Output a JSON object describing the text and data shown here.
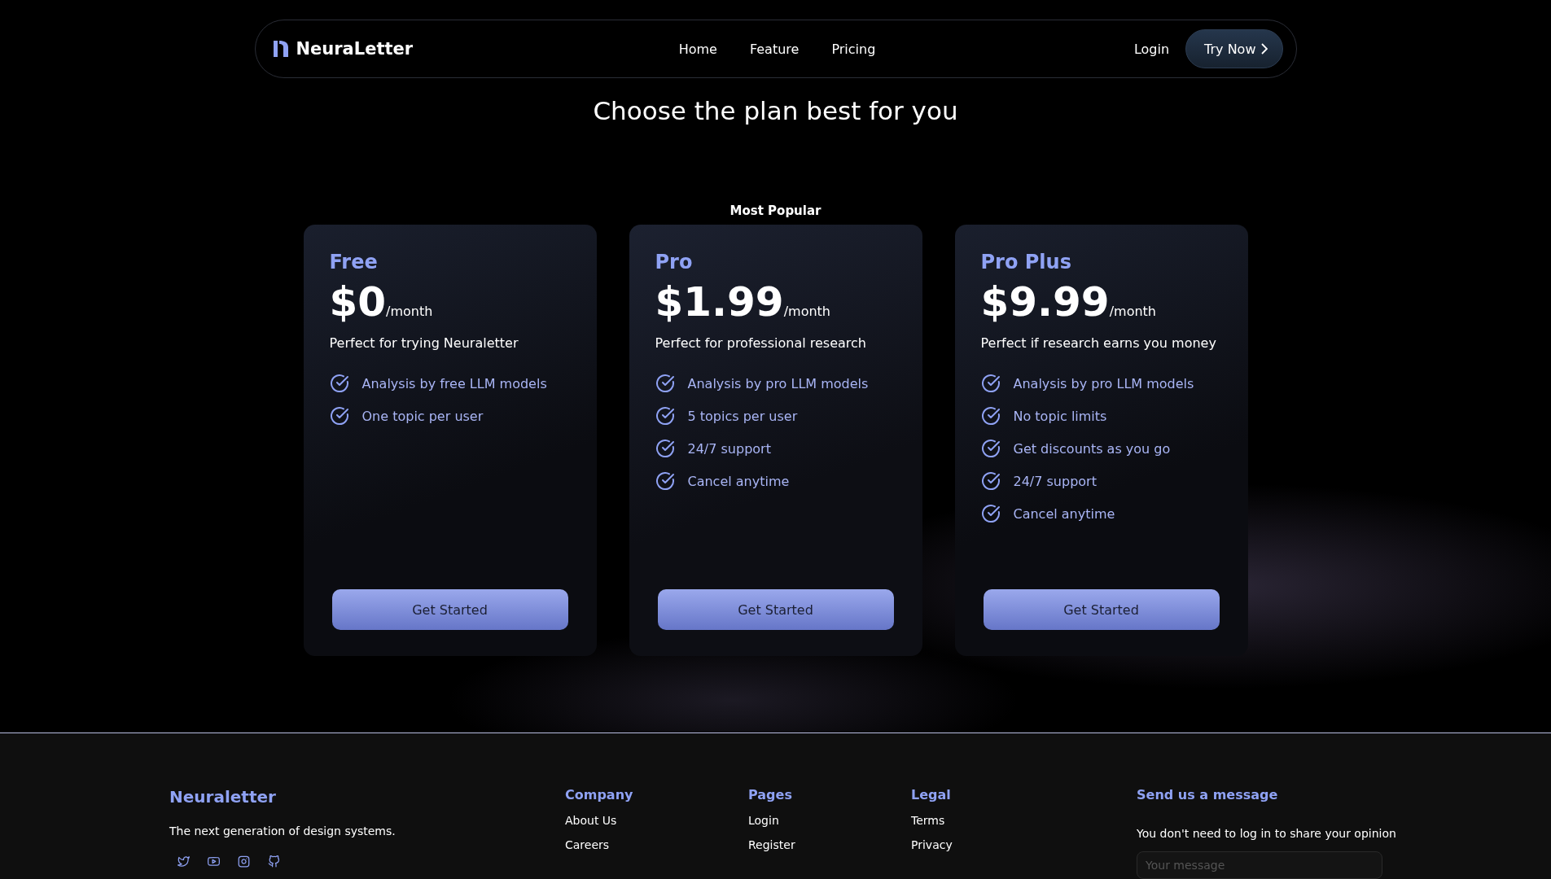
{
  "nav": {
    "brand": "NeuraLetter",
    "links": [
      "Home",
      "Feature",
      "Pricing"
    ],
    "login": "Login",
    "cta": "Try Now"
  },
  "heading": "Choose the plan best for you",
  "plans": [
    {
      "name": "Free",
      "price": "$0",
      "period": "/month",
      "description": "Perfect for trying Neuraletter",
      "features": [
        "Analysis by free LLM models",
        "One topic per user"
      ],
      "button": "Get Started"
    },
    {
      "name": "Pro",
      "price": "$1.99",
      "period": "/month",
      "description": "Perfect for professional research",
      "badge": "Most Popular",
      "features": [
        "Analysis by pro LLM models",
        "5 topics per user",
        "24/7 support",
        "Cancel anytime"
      ],
      "button": "Get Started"
    },
    {
      "name": "Pro Plus",
      "price": "$9.99",
      "period": "/month",
      "description": "Perfect if research earns you money",
      "features": [
        "Analysis by pro LLM models",
        "No topic limits",
        "Get discounts as you go",
        "24/7 support",
        "Cancel anytime"
      ],
      "button": "Get Started"
    }
  ],
  "footer": {
    "brand": "Neuraletter",
    "tagline": "The next generation of design systems.",
    "columns": [
      {
        "title": "Company",
        "links": [
          "About Us",
          "Careers"
        ]
      },
      {
        "title": "Pages",
        "links": [
          "Login",
          "Register"
        ]
      },
      {
        "title": "Legal",
        "links": [
          "Terms",
          "Privacy"
        ]
      }
    ],
    "message": {
      "title": "Send us a message",
      "note": "You don't need to log in to share your opinion",
      "placeholder": "Your message"
    }
  }
}
